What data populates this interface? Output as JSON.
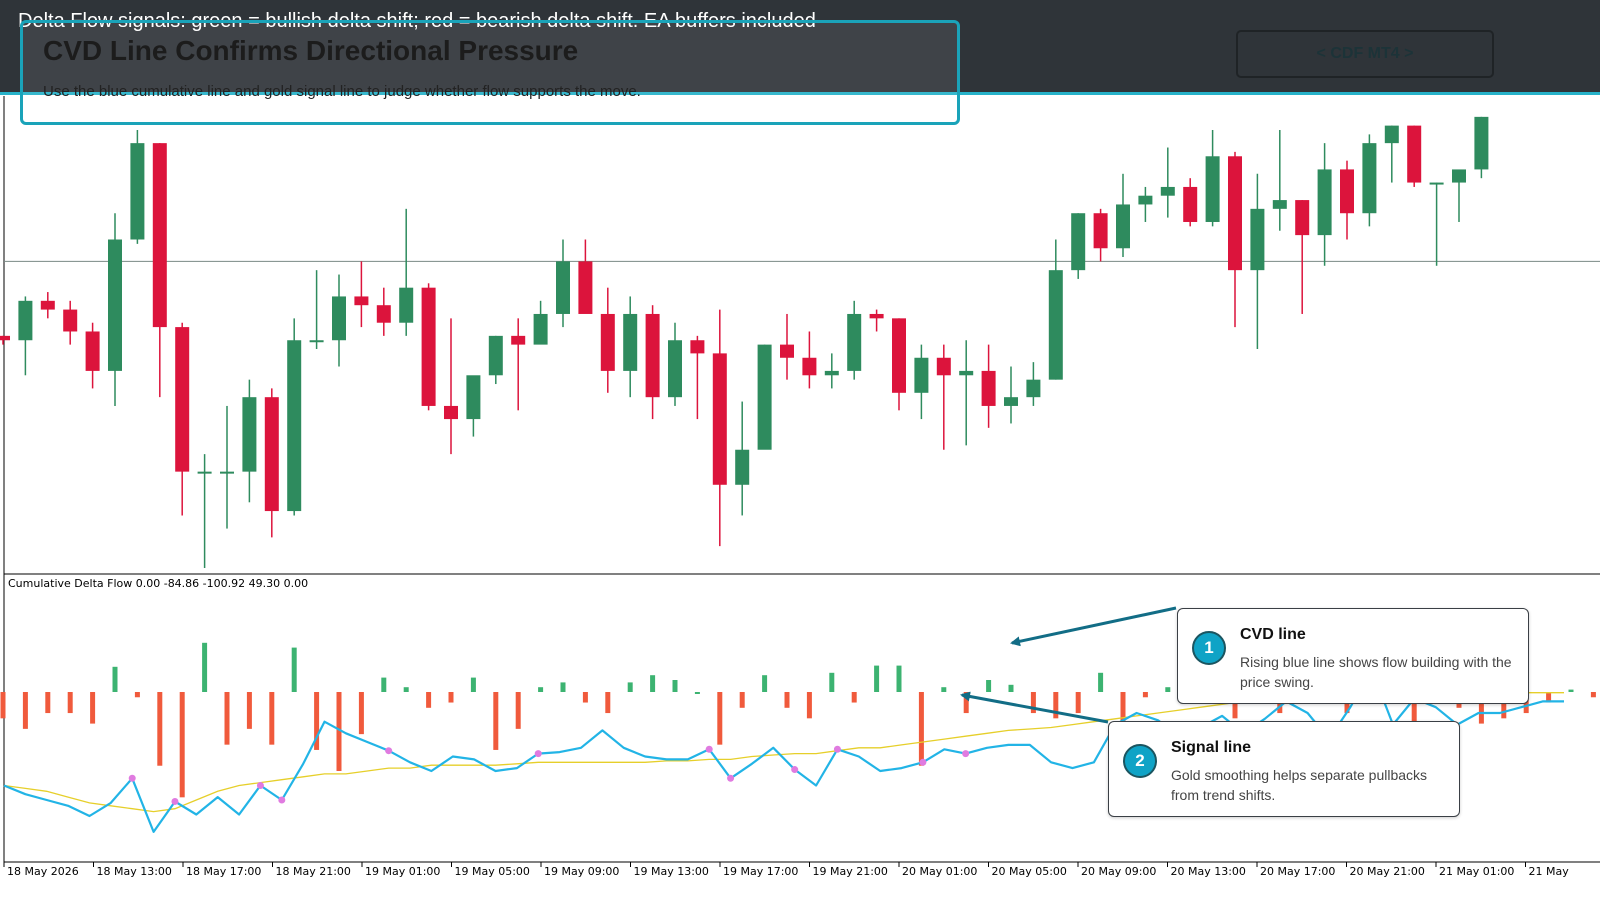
{
  "topbar": {
    "caption": "Delta Flow signals: green = bullish delta shift; red = bearish delta shift. EA buffers included"
  },
  "banner": {
    "title": "CVD Line Confirms Directional Pressure",
    "subtitle": "Use the blue cumulative line and gold signal line to judge whether flow supports the move."
  },
  "brand_button": {
    "label": "< CDF MT4 >"
  },
  "indicator": {
    "title": "Cumulative Delta Flow 0.00 -84.86 -100.92 49.30 0.00"
  },
  "callouts": [
    {
      "number": "1",
      "title": "CVD line",
      "body": "Rising blue line shows flow building with the price swing."
    },
    {
      "number": "2",
      "title": "Signal line",
      "body": "Gold smoothing helps separate pullbacks from trend shifts."
    }
  ],
  "colors": {
    "bull": "#2e8b5e",
    "bear": "#dc143c",
    "hist_bull": "#3cb371",
    "hist_bear": "#f05a3c",
    "cvd_line": "#22b4e6",
    "signal_line": "#e6cf2a",
    "dot": "#e07be0",
    "accent": "#1aa3b9",
    "arrow": "#126d86"
  },
  "chart_data": [
    {
      "type": "candlestick",
      "title": "",
      "xlabel": "",
      "ylabel": "",
      "ylim": [
        0,
        100
      ],
      "grid": false,
      "horizontal_line": 70,
      "candles": [
        {
          "o": 53,
          "h": 53,
          "l": 51,
          "c": 52
        },
        {
          "o": 52,
          "h": 62,
          "l": 44,
          "c": 61
        },
        {
          "o": 61,
          "h": 63,
          "l": 57,
          "c": 59
        },
        {
          "o": 59,
          "h": 61,
          "l": 51,
          "c": 54
        },
        {
          "o": 54,
          "h": 56,
          "l": 41,
          "c": 45
        },
        {
          "o": 45,
          "h": 81,
          "l": 37,
          "c": 75
        },
        {
          "o": 75,
          "h": 100,
          "l": 74,
          "c": 97
        },
        {
          "o": 97,
          "h": 97,
          "l": 39,
          "c": 55
        },
        {
          "o": 55,
          "h": 56,
          "l": 12,
          "c": 22
        },
        {
          "o": 22,
          "h": 26,
          "l": 0,
          "c": 22
        },
        {
          "o": 22,
          "h": 37,
          "l": 9,
          "c": 22
        },
        {
          "o": 22,
          "h": 43,
          "l": 15,
          "c": 39
        },
        {
          "o": 39,
          "h": 41,
          "l": 7,
          "c": 13
        },
        {
          "o": 13,
          "h": 57,
          "l": 12,
          "c": 52
        },
        {
          "o": 52,
          "h": 68,
          "l": 50,
          "c": 52
        },
        {
          "o": 52,
          "h": 67,
          "l": 46,
          "c": 62
        },
        {
          "o": 62,
          "h": 70,
          "l": 55,
          "c": 60
        },
        {
          "o": 60,
          "h": 64,
          "l": 53,
          "c": 56
        },
        {
          "o": 56,
          "h": 82,
          "l": 53,
          "c": 64
        },
        {
          "o": 64,
          "h": 65,
          "l": 36,
          "c": 37
        },
        {
          "o": 37,
          "h": 57,
          "l": 26,
          "c": 34
        },
        {
          "o": 34,
          "h": 43,
          "l": 30,
          "c": 44
        },
        {
          "o": 44,
          "h": 53,
          "l": 42,
          "c": 53
        },
        {
          "o": 53,
          "h": 57,
          "l": 36,
          "c": 51
        },
        {
          "o": 51,
          "h": 61,
          "l": 52,
          "c": 58
        },
        {
          "o": 58,
          "h": 75,
          "l": 55,
          "c": 70
        },
        {
          "o": 70,
          "h": 75,
          "l": 59,
          "c": 58
        },
        {
          "o": 58,
          "h": 64,
          "l": 40,
          "c": 45
        },
        {
          "o": 45,
          "h": 62,
          "l": 39,
          "c": 58
        },
        {
          "o": 58,
          "h": 60,
          "l": 34,
          "c": 39
        },
        {
          "o": 39,
          "h": 56,
          "l": 37,
          "c": 52
        },
        {
          "o": 52,
          "h": 53,
          "l": 34,
          "c": 49
        },
        {
          "o": 49,
          "h": 59,
          "l": 5,
          "c": 19
        },
        {
          "o": 19,
          "h": 38,
          "l": 12,
          "c": 27
        },
        {
          "o": 27,
          "h": 51,
          "l": 28,
          "c": 51
        },
        {
          "o": 51,
          "h": 58,
          "l": 43,
          "c": 48
        },
        {
          "o": 48,
          "h": 54,
          "l": 41,
          "c": 44
        },
        {
          "o": 44,
          "h": 49,
          "l": 41,
          "c": 45
        },
        {
          "o": 45,
          "h": 61,
          "l": 43,
          "c": 58
        },
        {
          "o": 58,
          "h": 59,
          "l": 54,
          "c": 57
        },
        {
          "o": 57,
          "h": 57,
          "l": 36,
          "c": 40
        },
        {
          "o": 40,
          "h": 51,
          "l": 34,
          "c": 48
        },
        {
          "o": 48,
          "h": 51,
          "l": 27,
          "c": 44
        },
        {
          "o": 44,
          "h": 52,
          "l": 28,
          "c": 45
        },
        {
          "o": 45,
          "h": 51,
          "l": 32,
          "c": 37
        },
        {
          "o": 37,
          "h": 46,
          "l": 33,
          "c": 39
        },
        {
          "o": 39,
          "h": 47,
          "l": 37,
          "c": 43
        },
        {
          "o": 43,
          "h": 75,
          "l": 43,
          "c": 68
        },
        {
          "o": 68,
          "h": 81,
          "l": 66,
          "c": 81
        },
        {
          "o": 81,
          "h": 82,
          "l": 70,
          "c": 73
        },
        {
          "o": 73,
          "h": 90,
          "l": 71,
          "c": 83
        },
        {
          "o": 83,
          "h": 87,
          "l": 79,
          "c": 85
        },
        {
          "o": 85,
          "h": 96,
          "l": 80,
          "c": 87
        },
        {
          "o": 87,
          "h": 89,
          "l": 78,
          "c": 79
        },
        {
          "o": 79,
          "h": 100,
          "l": 78,
          "c": 94
        },
        {
          "o": 94,
          "h": 95,
          "l": 55,
          "c": 68
        },
        {
          "o": 68,
          "h": 90,
          "l": 50,
          "c": 82
        },
        {
          "o": 82,
          "h": 100,
          "l": 77,
          "c": 84
        },
        {
          "o": 84,
          "h": 84,
          "l": 58,
          "c": 76
        },
        {
          "o": 76,
          "h": 97,
          "l": 69,
          "c": 91
        },
        {
          "o": 91,
          "h": 93,
          "l": 75,
          "c": 81
        },
        {
          "o": 81,
          "h": 99,
          "l": 78,
          "c": 97
        },
        {
          "o": 97,
          "h": 101,
          "l": 88,
          "c": 101
        },
        {
          "o": 101,
          "h": 101,
          "l": 87,
          "c": 88
        },
        {
          "o": 88,
          "h": 88,
          "l": 69,
          "c": 88
        },
        {
          "o": 88,
          "h": 89,
          "l": 79,
          "c": 91
        },
        {
          "o": 91,
          "h": 103,
          "l": 89,
          "c": 103
        }
      ]
    },
    {
      "type": "bar",
      "title": "Cumulative Delta Flow 0.00 -84.86 -100.92 49.30 0.00",
      "ylim": [
        -60,
        60
      ],
      "x_tick_labels": [
        "18 May 2026",
        "18 May 13:00",
        "18 May 17:00",
        "18 May 21:00",
        "19 May 01:00",
        "19 May 05:00",
        "19 May 09:00",
        "19 May 13:00",
        "19 May 17:00",
        "19 May 21:00",
        "20 May 01:00",
        "20 May 05:00",
        "20 May 09:00",
        "20 May 13:00",
        "20 May 17:00",
        "20 May 21:00",
        "21 May 01:00",
        "21 May"
      ],
      "histogram": [
        -10,
        -14,
        -8,
        -8,
        -12,
        21,
        -2,
        -28,
        -40,
        41,
        -20,
        -14,
        -20,
        37,
        -22,
        -30,
        -16,
        12,
        4,
        -6,
        -4,
        12,
        -22,
        -14,
        4,
        8,
        -4,
        -8,
        8,
        14,
        10,
        0,
        -20,
        -6,
        14,
        -6,
        -10,
        16,
        -4,
        22,
        22,
        -28,
        4,
        -8,
        10,
        6,
        -8,
        -10,
        -8,
        16,
        -14,
        -2,
        4,
        6,
        10,
        -10,
        8,
        -8,
        4,
        4,
        -8,
        4,
        -2,
        -12,
        -4,
        -6,
        -12,
        -10,
        -8,
        -4,
        2,
        -2,
        -2,
        6
      ],
      "series": [
        {
          "name": "CVD",
          "values": [
            -30,
            -36,
            -40,
            -44,
            -51,
            -42,
            -25,
            -62,
            -41,
            -50,
            -38,
            -50,
            -30,
            -40,
            -15,
            14,
            6,
            0,
            -6,
            -14,
            -20,
            -10,
            -12,
            -20,
            -18,
            -8,
            -7,
            -4,
            8,
            -4,
            -10,
            -12,
            -12,
            -5,
            -25,
            -15,
            -4,
            -19,
            -30,
            -5,
            -10,
            -20,
            -18,
            -14,
            -5,
            -8,
            -4,
            -2,
            -2,
            -14,
            -18,
            -14,
            12,
            20,
            15,
            4,
            10,
            18,
            6,
            16,
            28,
            20,
            2,
            24,
            50,
            12,
            30,
            24,
            12,
            20,
            20,
            24,
            28,
            28
          ]
        },
        {
          "name": "Signal",
          "values": [
            -30,
            -32,
            -34,
            -38,
            -42,
            -44,
            -46,
            -48,
            -46,
            -40,
            -34,
            -30,
            -28,
            -26,
            -24,
            -22,
            -22,
            -20,
            -18,
            -18,
            -16,
            -16,
            -16,
            -16,
            -15,
            -14,
            -14,
            -14,
            -14,
            -14,
            -14,
            -13,
            -13,
            -12,
            -12,
            -10,
            -9,
            -8,
            -8,
            -6,
            -4,
            -4,
            -2,
            0,
            2,
            4,
            6,
            8,
            9,
            10,
            12,
            14,
            16,
            18,
            20,
            22,
            24,
            26,
            28,
            30,
            30,
            31,
            32,
            34,
            34,
            34,
            34,
            34,
            34,
            34,
            34,
            34,
            34,
            34
          ]
        }
      ]
    }
  ]
}
